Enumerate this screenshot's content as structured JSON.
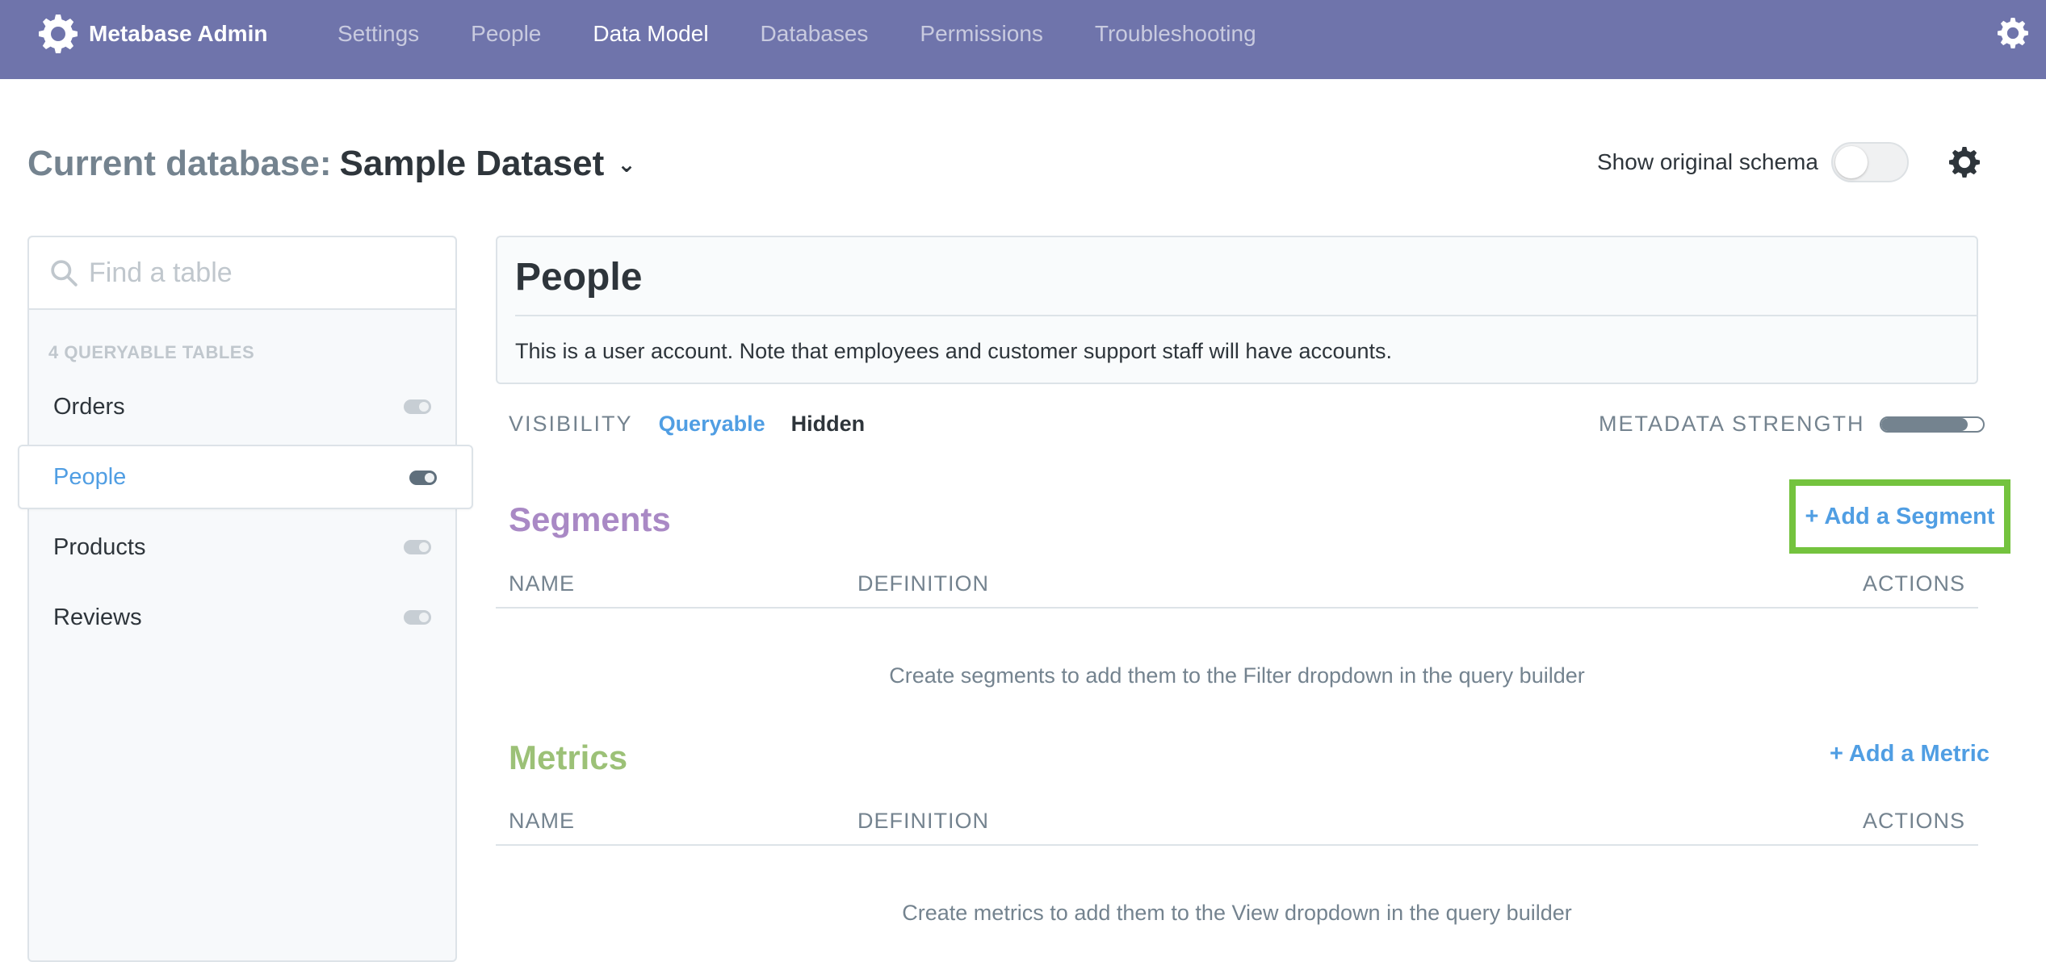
{
  "nav": {
    "brand": "Metabase Admin",
    "items": [
      {
        "label": "Settings",
        "active": false
      },
      {
        "label": "People",
        "active": false
      },
      {
        "label": "Data Model",
        "active": true
      },
      {
        "label": "Databases",
        "active": false
      },
      {
        "label": "Permissions",
        "active": false
      },
      {
        "label": "Troubleshooting",
        "active": false
      }
    ],
    "gear_icon": "gear-icon"
  },
  "header": {
    "prefix": "Current database:",
    "database": "Sample Dataset",
    "chevron": "⌄",
    "schema_toggle_label": "Show original schema",
    "schema_toggle_on": false
  },
  "sidebar": {
    "search_placeholder": "Find a table",
    "count_label": "4 QUERYABLE TABLES",
    "tables": [
      {
        "label": "Orders",
        "active": false
      },
      {
        "label": "People",
        "active": true
      },
      {
        "label": "Products",
        "active": false
      },
      {
        "label": "Reviews",
        "active": false
      }
    ]
  },
  "table": {
    "name": "People",
    "description": "This is a user account. Note that employees and customer support staff will have accounts."
  },
  "visibility": {
    "label": "VISIBILITY",
    "queryable": "Queryable",
    "hidden": "Hidden",
    "selected": "Queryable"
  },
  "metadata": {
    "label": "METADATA STRENGTH",
    "strength": 0.85
  },
  "segments": {
    "title": "Segments",
    "add_label": "+ Add a Segment",
    "columns": {
      "name": "NAME",
      "definition": "DEFINITION",
      "actions": "ACTIONS"
    },
    "empty": "Create segments to add them to the Filter dropdown in the query builder"
  },
  "metrics": {
    "title": "Metrics",
    "add_label": "+ Add a Metric",
    "columns": {
      "name": "NAME",
      "definition": "DEFINITION",
      "actions": "ACTIONS"
    },
    "empty": "Create metrics to add them to the View dropdown in the query builder"
  },
  "colors": {
    "nav_bg": "#6f74ab",
    "accent_blue": "#509ee3",
    "segments_purple": "#a989c5",
    "metrics_green": "#9cc177",
    "highlight_green": "#74c33e"
  }
}
